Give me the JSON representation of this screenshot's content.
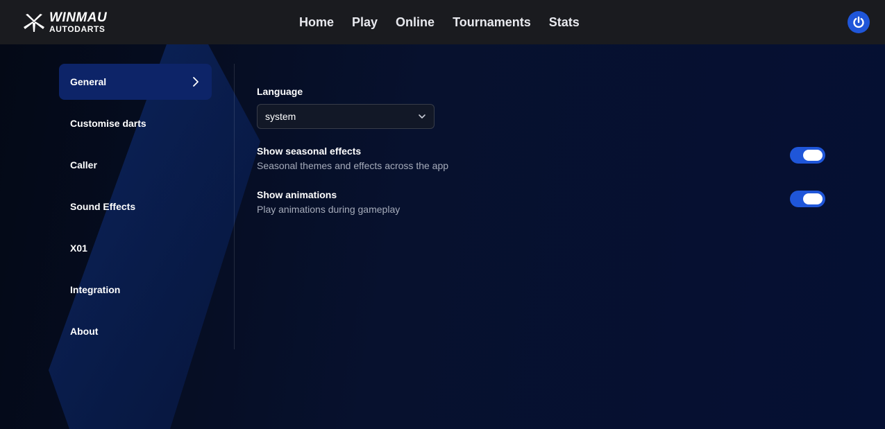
{
  "brand": {
    "line1": "WINMAU",
    "line2": "AUTODARTS"
  },
  "nav": {
    "items": [
      "Home",
      "Play",
      "Online",
      "Tournaments",
      "Stats"
    ]
  },
  "header": {
    "power_icon": "power-icon"
  },
  "sidebar": {
    "items": [
      {
        "label": "General",
        "active": true
      },
      {
        "label": "Customise darts"
      },
      {
        "label": "Caller"
      },
      {
        "label": "Sound Effects"
      },
      {
        "label": "X01"
      },
      {
        "label": "Integration"
      },
      {
        "label": "About"
      }
    ]
  },
  "settings": {
    "language": {
      "label": "Language",
      "value": "system"
    },
    "seasonal": {
      "title": "Show seasonal effects",
      "description": "Seasonal themes and effects across the app",
      "enabled": true
    },
    "animations": {
      "title": "Show animations",
      "description": "Play animations during gameplay",
      "enabled": true
    }
  },
  "colors": {
    "accent": "#1f56d9",
    "active_item": "#0d2468",
    "topbar": "#1a1b1f"
  }
}
